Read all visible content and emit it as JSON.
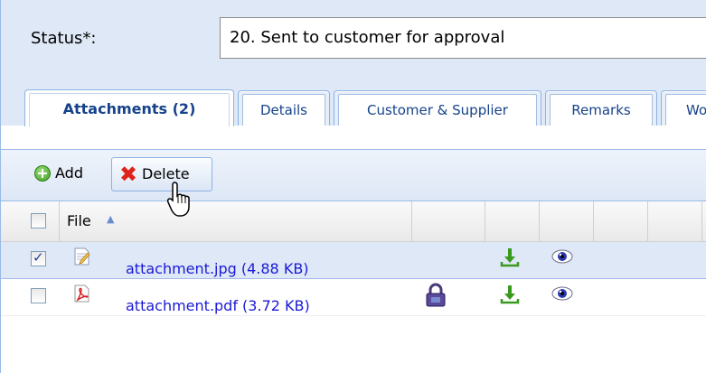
{
  "status": {
    "label": "Status*:",
    "value": "20. Sent to customer for approval"
  },
  "tabs": [
    {
      "label": "Attachments (2)",
      "active": true
    },
    {
      "label": "Details",
      "active": false
    },
    {
      "label": "Customer & Supplier",
      "active": false
    },
    {
      "label": "Remarks",
      "active": false
    },
    {
      "label": "Wo",
      "active": false
    }
  ],
  "toolbar": {
    "add_label": "Add",
    "delete_label": "Delete"
  },
  "grid": {
    "column_file": "File",
    "sort": "ascending",
    "rows": [
      {
        "name": "attachment.jpg (4.88 KB)",
        "checked": true,
        "type_icon": "image-file-icon",
        "locked": false
      },
      {
        "name": "attachment.pdf (3.72 KB)",
        "checked": false,
        "type_icon": "pdf-file-icon",
        "locked": true
      }
    ]
  },
  "colors": {
    "panel_bg": "#dfe8f6",
    "tab_text": "#15428b",
    "link": "#1a1ad6",
    "download_green": "#3a9a1e",
    "delete_red": "#e0231a"
  }
}
